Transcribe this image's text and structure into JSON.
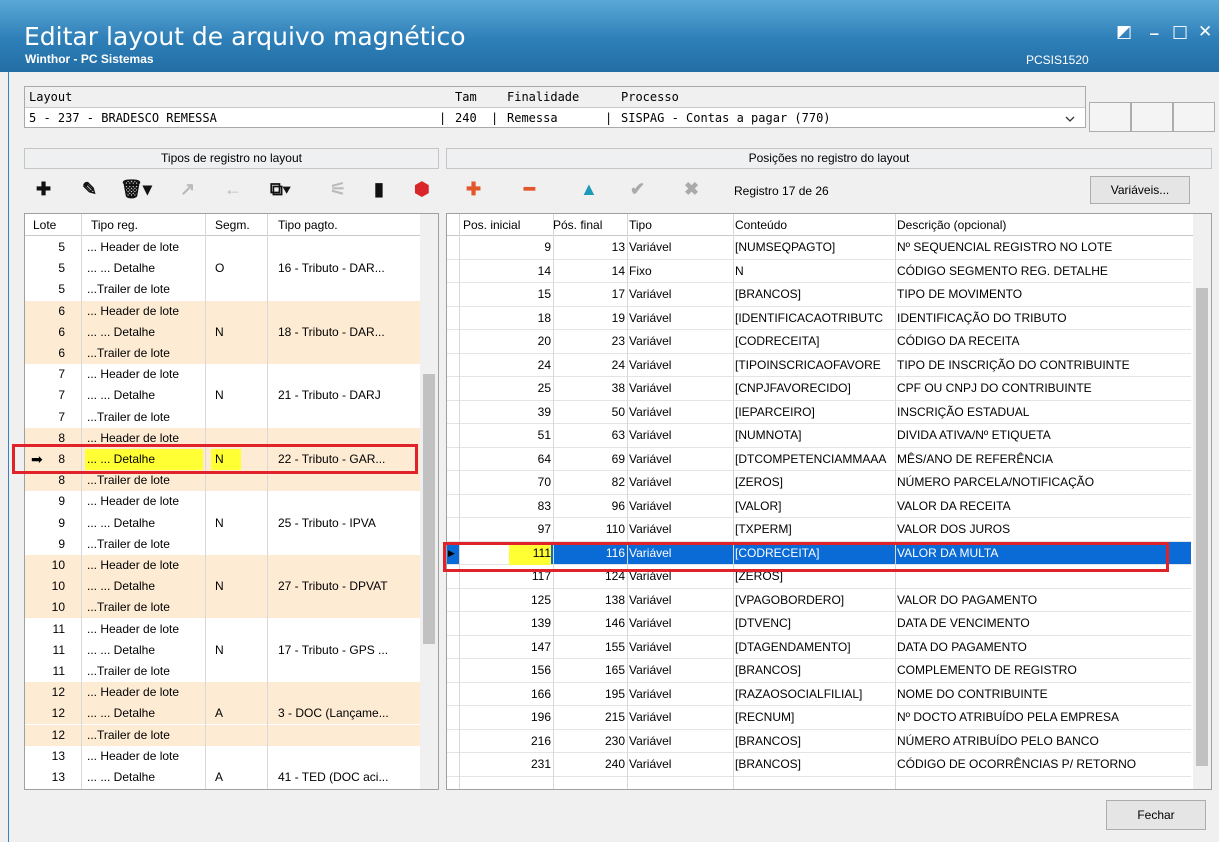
{
  "window": {
    "title": "Editar layout de arquivo magnético",
    "subtitle": "Winthor - PC Sistemas",
    "code": "PCSIS1520",
    "ctl_restore": "◩",
    "ctl_min": "_",
    "ctl_max": "□",
    "ctl_close": "✕"
  },
  "layout_bar": {
    "label_layout": "Layout",
    "label_tam": "Tam",
    "label_finalidade": "Finalidade",
    "label_processo": "Processo",
    "layout_value": "5 - 237 - BRADESCO REMESSA",
    "sep1": "|",
    "tam_value": "240",
    "sep2": "|",
    "finalidade_value": "Remessa",
    "sep3": "|",
    "processo_value": "SISPAG - Contas a pagar (770)",
    "dropdown_icon": "chevron-down"
  },
  "left": {
    "title": "Tipos de registro no layout",
    "columns": [
      "Lote",
      "Tipo reg.",
      "Segm.",
      "Tipo pagto."
    ],
    "rows": [
      {
        "lote": "5",
        "tipo": "... Header de lote",
        "segm": "",
        "pagto": ""
      },
      {
        "lote": "5",
        "tipo": "... ... Detalhe",
        "segm": "O",
        "pagto": "16 - Tributo - DAR..."
      },
      {
        "lote": "5",
        "tipo": "...Trailer de lote",
        "segm": "",
        "pagto": ""
      },
      {
        "lote": "6",
        "tipo": "... Header de lote",
        "segm": "",
        "pagto": ""
      },
      {
        "lote": "6",
        "tipo": "... ... Detalhe",
        "segm": "N",
        "pagto": "18 - Tributo - DAR..."
      },
      {
        "lote": "6",
        "tipo": "...Trailer de lote",
        "segm": "",
        "pagto": ""
      },
      {
        "lote": "7",
        "tipo": "... Header de lote",
        "segm": "",
        "pagto": ""
      },
      {
        "lote": "7",
        "tipo": "... ... Detalhe",
        "segm": "N",
        "pagto": "21 - Tributo - DARJ"
      },
      {
        "lote": "7",
        "tipo": "...Trailer de lote",
        "segm": "",
        "pagto": ""
      },
      {
        "lote": "8",
        "tipo": "... Header de lote",
        "segm": "",
        "pagto": ""
      },
      {
        "lote": "8",
        "tipo": "... ... Detalhe",
        "segm": "N",
        "pagto": "22 - Tributo - GAR..."
      },
      {
        "lote": "8",
        "tipo": "...Trailer de lote",
        "segm": "",
        "pagto": ""
      },
      {
        "lote": "9",
        "tipo": "... Header de lote",
        "segm": "",
        "pagto": ""
      },
      {
        "lote": "9",
        "tipo": "... ... Detalhe",
        "segm": "N",
        "pagto": "25 - Tributo - IPVA"
      },
      {
        "lote": "9",
        "tipo": "...Trailer de lote",
        "segm": "",
        "pagto": ""
      },
      {
        "lote": "10",
        "tipo": "... Header de lote",
        "segm": "",
        "pagto": ""
      },
      {
        "lote": "10",
        "tipo": "... ... Detalhe",
        "segm": "N",
        "pagto": "27 - Tributo - DPVAT"
      },
      {
        "lote": "10",
        "tipo": "...Trailer de lote",
        "segm": "",
        "pagto": ""
      },
      {
        "lote": "11",
        "tipo": "... Header de lote",
        "segm": "",
        "pagto": ""
      },
      {
        "lote": "11",
        "tipo": "... ... Detalhe",
        "segm": "N",
        "pagto": "17 - Tributo - GPS ..."
      },
      {
        "lote": "11",
        "tipo": "...Trailer de lote",
        "segm": "",
        "pagto": ""
      },
      {
        "lote": "12",
        "tipo": "... Header de lote",
        "segm": "",
        "pagto": ""
      },
      {
        "lote": "12",
        "tipo": "... ... Detalhe",
        "segm": "A",
        "pagto": "3 - DOC (Lançame..."
      },
      {
        "lote": "12",
        "tipo": "...Trailer de lote",
        "segm": "",
        "pagto": ""
      },
      {
        "lote": "13",
        "tipo": "... Header de lote",
        "segm": "",
        "pagto": ""
      },
      {
        "lote": "13",
        "tipo": "... ... Detalhe",
        "segm": "A",
        "pagto": "41 - TED (DOC aci..."
      }
    ]
  },
  "right": {
    "title": "Posições no registro do layout",
    "record_info": "Registro 17 de 26",
    "variables_button": "Variáveis...",
    "columns": [
      "Pos. inicial",
      "Pós. final",
      "Tipo",
      "Conteúdo",
      "Descrição (opcional)"
    ],
    "rows": [
      {
        "ini": "9",
        "fim": "13",
        "tipo": "Variável",
        "cont": "[NUMSEQPAGTO]",
        "desc": "Nº SEQUENCIAL REGISTRO NO LOTE"
      },
      {
        "ini": "14",
        "fim": "14",
        "tipo": "Fixo",
        "cont": "N",
        "desc": "CÓDIGO SEGMENTO REG. DETALHE"
      },
      {
        "ini": "15",
        "fim": "17",
        "tipo": "Variável",
        "cont": "[BRANCOS]",
        "desc": "TIPO DE MOVIMENTO"
      },
      {
        "ini": "18",
        "fim": "19",
        "tipo": "Variável",
        "cont": "[IDENTIFICACAOTRIBUTC",
        "desc": "IDENTIFICAÇÃO DO TRIBUTO"
      },
      {
        "ini": "20",
        "fim": "23",
        "tipo": "Variável",
        "cont": "[CODRECEITA]",
        "desc": "CÓDIGO DA RECEITA"
      },
      {
        "ini": "24",
        "fim": "24",
        "tipo": "Variável",
        "cont": "[TIPOINSCRICAOFAVORE",
        "desc": "TIPO DE INSCRIÇÃO DO CONTRIBUINTE"
      },
      {
        "ini": "25",
        "fim": "38",
        "tipo": "Variável",
        "cont": "[CNPJFAVORECIDO]",
        "desc": "CPF OU CNPJ DO CONTRIBUINTE"
      },
      {
        "ini": "39",
        "fim": "50",
        "tipo": "Variável",
        "cont": "[IEPARCEIRO]",
        "desc": "INSCRIÇÃO ESTADUAL"
      },
      {
        "ini": "51",
        "fim": "63",
        "tipo": "Variável",
        "cont": "[NUMNOTA]",
        "desc": "DIVIDA ATIVA/Nº ETIQUETA"
      },
      {
        "ini": "64",
        "fim": "69",
        "tipo": "Variável",
        "cont": "[DTCOMPETENCIAMMAAA",
        "desc": "MÊS/ANO DE REFERÊNCIA"
      },
      {
        "ini": "70",
        "fim": "82",
        "tipo": "Variável",
        "cont": "[ZEROS]",
        "desc": "NÚMERO PARCELA/NOTIFICAÇÃO"
      },
      {
        "ini": "83",
        "fim": "96",
        "tipo": "Variável",
        "cont": "[VALOR]",
        "desc": "VALOR DA RECEITA"
      },
      {
        "ini": "97",
        "fim": "110",
        "tipo": "Variável",
        "cont": "[TXPERM]",
        "desc": "VALOR DOS JUROS"
      },
      {
        "ini": "111",
        "fim": "116",
        "tipo": "Variável",
        "cont": "[CODRECEITA]",
        "desc": "VALOR DA MULTA"
      },
      {
        "ini": "117",
        "fim": "124",
        "tipo": "Variável",
        "cont": "[ZEROS]",
        "desc": ""
      },
      {
        "ini": "125",
        "fim": "138",
        "tipo": "Variável",
        "cont": "[VPAGOBORDERO]",
        "desc": "VALOR DO PAGAMENTO"
      },
      {
        "ini": "139",
        "fim": "146",
        "tipo": "Variável",
        "cont": "[DTVENC]",
        "desc": "DATA DE VENCIMENTO"
      },
      {
        "ini": "147",
        "fim": "155",
        "tipo": "Variável",
        "cont": "[DTAGENDAMENTO]",
        "desc": "DATA DO PAGAMENTO"
      },
      {
        "ini": "156",
        "fim": "165",
        "tipo": "Variável",
        "cont": "[BRANCOS]",
        "desc": "COMPLEMENTO DE REGISTRO"
      },
      {
        "ini": "166",
        "fim": "195",
        "tipo": "Variável",
        "cont": "[RAZAOSOCIALFILIAL]",
        "desc": "NOME DO CONTRIBUINTE"
      },
      {
        "ini": "196",
        "fim": "215",
        "tipo": "Variável",
        "cont": "[RECNUM]",
        "desc": "Nº DOCTO ATRIBUÍDO PELA EMPRESA"
      },
      {
        "ini": "216",
        "fim": "230",
        "tipo": "Variável",
        "cont": "[BRANCOS]",
        "desc": "NÚMERO ATRIBUÍDO PELO BANCO"
      },
      {
        "ini": "231",
        "fim": "240",
        "tipo": "Variável",
        "cont": "[BRANCOS]",
        "desc": "CÓDIGO DE OCORRÊNCIAS P/ RETORNO"
      }
    ]
  },
  "footer": {
    "close_button": "Fechar"
  },
  "colors": {
    "accent_title": "#2e7fb8",
    "selected_row": "#0a6ad6",
    "highlight_yellow": "#ffff33",
    "callout_red": "#e0232a",
    "band_orange": "#fdebd3"
  }
}
